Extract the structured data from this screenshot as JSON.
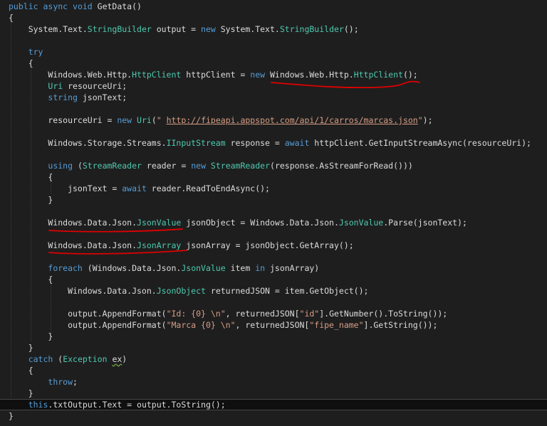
{
  "code_lines": [
    [
      {
        "t": "public ",
        "c": "kw"
      },
      {
        "t": "async ",
        "c": "kw"
      },
      {
        "t": "void ",
        "c": "kw"
      },
      {
        "t": "GetData()",
        "c": "plain"
      }
    ],
    [
      {
        "t": "{",
        "c": "plain"
      }
    ],
    [
      {
        "t": "    System.Text.",
        "c": "plain"
      },
      {
        "t": "StringBuilder",
        "c": "type"
      },
      {
        "t": " output = ",
        "c": "plain"
      },
      {
        "t": "new ",
        "c": "kw"
      },
      {
        "t": "System.Text.",
        "c": "plain"
      },
      {
        "t": "StringBuilder",
        "c": "type"
      },
      {
        "t": "();",
        "c": "plain"
      }
    ],
    [],
    [
      {
        "t": "    ",
        "c": "plain"
      },
      {
        "t": "try",
        "c": "kw"
      }
    ],
    [
      {
        "t": "    {",
        "c": "plain"
      }
    ],
    [
      {
        "t": "        Windows.Web.Http.",
        "c": "plain"
      },
      {
        "t": "HttpClient",
        "c": "type"
      },
      {
        "t": " httpClient = ",
        "c": "plain"
      },
      {
        "t": "new ",
        "c": "kw"
      },
      {
        "t": "Windows.Web.Http.",
        "c": "plain"
      },
      {
        "t": "HttpClient",
        "c": "type"
      },
      {
        "t": "();",
        "c": "plain"
      }
    ],
    [
      {
        "t": "        ",
        "c": "plain"
      },
      {
        "t": "Uri",
        "c": "type"
      },
      {
        "t": " resourceUri;",
        "c": "plain"
      }
    ],
    [
      {
        "t": "        ",
        "c": "plain"
      },
      {
        "t": "string",
        "c": "kw"
      },
      {
        "t": " jsonText;",
        "c": "plain"
      }
    ],
    [],
    [
      {
        "t": "        resourceUri = ",
        "c": "plain"
      },
      {
        "t": "new ",
        "c": "kw"
      },
      {
        "t": "Uri",
        "c": "type"
      },
      {
        "t": "(",
        "c": "plain"
      },
      {
        "t": "\" ",
        "c": "str"
      },
      {
        "t": "http://fipeapi.appspot.com/api/1/carros/marcas.json",
        "c": "url"
      },
      {
        "t": "\"",
        "c": "str"
      },
      {
        "t": ");",
        "c": "plain"
      }
    ],
    [],
    [
      {
        "t": "        Windows.Storage.Streams.",
        "c": "plain"
      },
      {
        "t": "IInputStream",
        "c": "type"
      },
      {
        "t": " response = ",
        "c": "plain"
      },
      {
        "t": "await ",
        "c": "kw"
      },
      {
        "t": "httpClient.GetInputStreamAsync(resourceUri);",
        "c": "plain"
      }
    ],
    [],
    [
      {
        "t": "        ",
        "c": "plain"
      },
      {
        "t": "using ",
        "c": "kw"
      },
      {
        "t": "(",
        "c": "plain"
      },
      {
        "t": "StreamReader",
        "c": "type"
      },
      {
        "t": " reader = ",
        "c": "plain"
      },
      {
        "t": "new ",
        "c": "kw"
      },
      {
        "t": "StreamReader",
        "c": "type"
      },
      {
        "t": "(response.AsStreamForRead()))",
        "c": "plain"
      }
    ],
    [
      {
        "t": "        {",
        "c": "plain"
      }
    ],
    [
      {
        "t": "            jsonText = ",
        "c": "plain"
      },
      {
        "t": "await ",
        "c": "kw"
      },
      {
        "t": "reader.ReadToEndAsync();",
        "c": "plain"
      }
    ],
    [
      {
        "t": "        }",
        "c": "plain"
      }
    ],
    [],
    [
      {
        "t": "        Windows.Data.Json.",
        "c": "plain"
      },
      {
        "t": "JsonValue",
        "c": "type"
      },
      {
        "t": " jsonObject = Windows.Data.Json.",
        "c": "plain"
      },
      {
        "t": "JsonValue",
        "c": "type"
      },
      {
        "t": ".Parse(jsonText);",
        "c": "plain"
      }
    ],
    [],
    [
      {
        "t": "        Windows.Data.Json.",
        "c": "plain"
      },
      {
        "t": "JsonArray",
        "c": "type"
      },
      {
        "t": " jsonArray = jsonObject.GetArray();",
        "c": "plain"
      }
    ],
    [],
    [
      {
        "t": "        ",
        "c": "plain"
      },
      {
        "t": "foreach ",
        "c": "kw"
      },
      {
        "t": "(Windows.Data.Json.",
        "c": "plain"
      },
      {
        "t": "JsonValue",
        "c": "type"
      },
      {
        "t": " item ",
        "c": "plain"
      },
      {
        "t": "in ",
        "c": "kw"
      },
      {
        "t": "jsonArray)",
        "c": "plain"
      }
    ],
    [
      {
        "t": "        {",
        "c": "plain"
      }
    ],
    [
      {
        "t": "            Windows.Data.Json.",
        "c": "plain"
      },
      {
        "t": "JsonObject",
        "c": "type"
      },
      {
        "t": " returnedJSON = item.GetObject();",
        "c": "plain"
      }
    ],
    [],
    [
      {
        "t": "            output.AppendFormat(",
        "c": "plain"
      },
      {
        "t": "\"Id: {0} \\n\"",
        "c": "str"
      },
      {
        "t": ", returnedJSON[",
        "c": "plain"
      },
      {
        "t": "\"id\"",
        "c": "str"
      },
      {
        "t": "].GetNumber().ToString());",
        "c": "plain"
      }
    ],
    [
      {
        "t": "            output.AppendFormat(",
        "c": "plain"
      },
      {
        "t": "\"Marca {0} \\n\"",
        "c": "str"
      },
      {
        "t": ", returnedJSON[",
        "c": "plain"
      },
      {
        "t": "\"fipe_name\"",
        "c": "str"
      },
      {
        "t": "].GetString());",
        "c": "plain"
      }
    ],
    [
      {
        "t": "        }",
        "c": "plain"
      }
    ],
    [
      {
        "t": "    }",
        "c": "plain"
      }
    ],
    [
      {
        "t": "    ",
        "c": "plain"
      },
      {
        "t": "catch ",
        "c": "kw"
      },
      {
        "t": "(",
        "c": "plain"
      },
      {
        "t": "Exception",
        "c": "type"
      },
      {
        "t": " ",
        "c": "plain"
      },
      {
        "t": "ex",
        "c": "plain",
        "sq": true
      },
      {
        "t": ")",
        "c": "plain"
      }
    ],
    [
      {
        "t": "    {",
        "c": "plain"
      }
    ],
    [
      {
        "t": "        ",
        "c": "plain"
      },
      {
        "t": "throw",
        "c": "kw"
      },
      {
        "t": ";",
        "c": "plain"
      }
    ],
    [
      {
        "t": "    }",
        "c": "plain"
      }
    ],
    [
      {
        "t": "    ",
        "c": "plain"
      },
      {
        "t": "this",
        "c": "kw"
      },
      {
        "t": ".txtOutput.Text = output.ToString();",
        "c": "plain"
      }
    ],
    [
      {
        "t": "}",
        "c": "plain"
      }
    ]
  ],
  "current_line": 35,
  "colors": {
    "background": "#1e1e1e",
    "keyword": "#569cd6",
    "type": "#4ec9b0",
    "string": "#d69d85",
    "text": "#dcdcdc",
    "annotation": "#e00000",
    "squiggle": "#7fae4e"
  }
}
